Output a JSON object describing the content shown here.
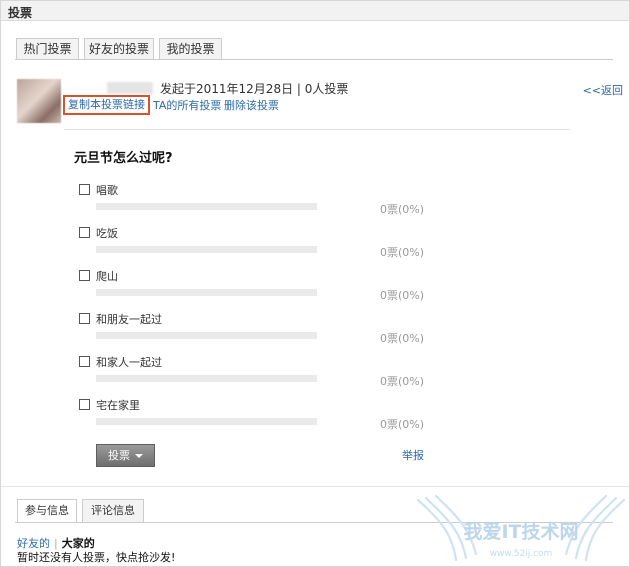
{
  "header": {
    "title": "投票"
  },
  "tabs": [
    {
      "label": "热门投票"
    },
    {
      "label": "好友的投票"
    },
    {
      "label": "我的投票"
    }
  ],
  "poll": {
    "meta": "发起于2011年12月28日  |  0人投票",
    "actions": {
      "copy_link": "复制本投票链接",
      "all_polls": "TA的所有投票",
      "delete": "删除该投票"
    },
    "back": "<<返回",
    "question": "元旦节怎么过呢?",
    "options": [
      {
        "label": "唱歌",
        "count": "0票(0%)",
        "percent": 0
      },
      {
        "label": "吃饭",
        "count": "0票(0%)",
        "percent": 0
      },
      {
        "label": "爬山",
        "count": "0票(0%)",
        "percent": 0
      },
      {
        "label": "和朋友一起过",
        "count": "0票(0%)",
        "percent": 0
      },
      {
        "label": "和家人一起过",
        "count": "0票(0%)",
        "percent": 0
      },
      {
        "label": "宅在家里",
        "count": "0票(0%)",
        "percent": 0
      }
    ],
    "vote_button": "投票",
    "report": "举报"
  },
  "bottom_tabs": [
    {
      "label": "参与信息"
    },
    {
      "label": "评论信息"
    }
  ],
  "participants": {
    "filter_friends": "好友的",
    "filter_all": "大家的",
    "empty_message": "暂时还没有人投票，快点抢沙发!"
  },
  "watermark": {
    "text": "我爱IT技术网",
    "url": "www.52ij.com"
  },
  "colors": {
    "link": "#2b6aa8",
    "highlight_border": "#d9532a",
    "vote_button": "#7f7f7f"
  }
}
